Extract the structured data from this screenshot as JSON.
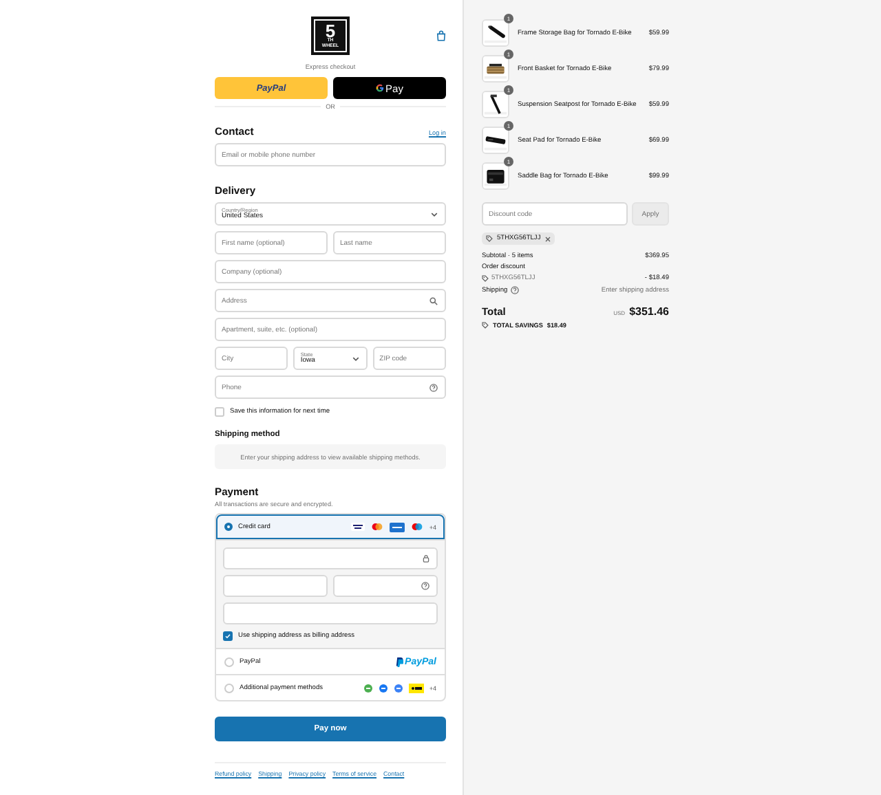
{
  "header": {
    "logo": {
      "numeral": "5",
      "lines": [
        "TH",
        "WHEEL"
      ]
    }
  },
  "express": {
    "title": "Express checkout",
    "buttons": [
      {
        "kind": "paypal",
        "label": "PayPal"
      },
      {
        "kind": "gpay",
        "label": "Pay"
      }
    ],
    "divider": "OR"
  },
  "contact": {
    "title": "Contact",
    "link": "Log in",
    "field": {
      "kind": "text",
      "placeholder": "Email or mobile phone number"
    }
  },
  "delivery": {
    "title": "Delivery",
    "rows": [
      [
        {
          "kind": "select",
          "label": "Country/Region",
          "value": "United States"
        }
      ],
      [
        {
          "kind": "text",
          "placeholder": "First name (optional)"
        },
        {
          "kind": "text",
          "placeholder": "Last name"
        }
      ],
      [
        {
          "kind": "text",
          "placeholder": "Company (optional)"
        }
      ],
      [
        {
          "kind": "search",
          "placeholder": "Address"
        }
      ],
      [
        {
          "kind": "text",
          "placeholder": "Apartment, suite, etc. (optional)"
        }
      ],
      [
        {
          "kind": "text",
          "placeholder": "City"
        },
        {
          "kind": "select",
          "label": "State",
          "value": "Iowa"
        },
        {
          "kind": "text",
          "placeholder": "ZIP code"
        }
      ],
      [
        {
          "kind": "help",
          "placeholder": "Phone"
        }
      ]
    ],
    "save": {
      "label": "Save this information for next time",
      "checked": false
    }
  },
  "shipping": {
    "title": "Shipping method",
    "notice": "Enter your shipping address to view available shipping methods."
  },
  "payment": {
    "title": "Payment",
    "subtitle": "All transactions are secure and encrypted.",
    "methods": [
      {
        "kind": "card",
        "label": "Credit card",
        "selected": true,
        "more": "+4",
        "card_rows": [
          [
            {
              "kind": "lock"
            }
          ],
          [
            {
              "kind": "blank"
            },
            {
              "kind": "help"
            }
          ],
          [
            {
              "kind": "blank"
            }
          ]
        ],
        "billing": {
          "label": "Use shipping address as billing address",
          "checked": true
        }
      },
      {
        "kind": "paypal",
        "label": "PayPal",
        "selected": false,
        "logo": "PayPal"
      },
      {
        "kind": "other",
        "label": "Additional payment methods",
        "selected": false,
        "more": "+4"
      }
    ],
    "button": "Pay now"
  },
  "footer": {
    "links": [
      "Refund policy",
      "Shipping",
      "Privacy policy",
      "Terms of service",
      "Contact"
    ]
  },
  "summary": {
    "items": [
      {
        "name": "Frame Storage Bag for Tornado E-Bike",
        "price": "$59.99",
        "quantity": "1"
      },
      {
        "name": "Front Basket for Tornado E-Bike",
        "price": "$79.99",
        "quantity": "1"
      },
      {
        "name": "Suspension Seatpost for Tornado E-Bike",
        "price": "$59.99",
        "quantity": "1"
      },
      {
        "name": "Seat Pad for Tornado E-Bike",
        "price": "$69.99",
        "quantity": "1"
      },
      {
        "name": "Saddle Bag for Tornado E-Bike",
        "price": "$99.99",
        "quantity": "1"
      }
    ],
    "discount": {
      "placeholder": "Discount code",
      "button": "Apply"
    },
    "applied_code": "5THXG56TLJJ",
    "lines": [
      {
        "kind": "line",
        "label": "Subtotal · 5 items",
        "value": "$369.95"
      },
      {
        "kind": "heading",
        "label": "Order discount"
      },
      {
        "kind": "code",
        "label": "5THXG56TLJJ",
        "value": "- $18.49"
      },
      {
        "kind": "help",
        "label": "Shipping",
        "value": "Enter shipping address"
      }
    ],
    "total": {
      "label": "Total",
      "currency": "USD",
      "value": "$351.46"
    },
    "savings": {
      "label": "TOTAL SAVINGS",
      "value": "$18.49"
    }
  }
}
